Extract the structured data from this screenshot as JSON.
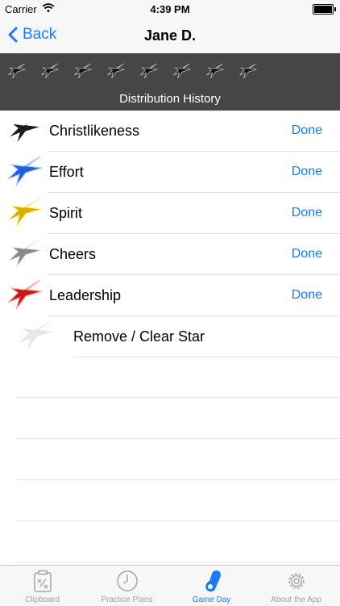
{
  "status_bar": {
    "carrier": "Carrier",
    "time": "4:39 PM"
  },
  "nav": {
    "back_label": "Back",
    "title": "Jane D."
  },
  "history": {
    "title": "Distribution History",
    "star_count": 8
  },
  "items": [
    {
      "label": "Christlikeness",
      "action": "Done",
      "star_color": "#1c1c1c",
      "star_highlight": "#ffffff"
    },
    {
      "label": "Effort",
      "action": "Done",
      "star_color": "#1f5fe0",
      "star_highlight": "#a9c8ff"
    },
    {
      "label": "Spirit",
      "action": "Done",
      "star_color": "#d8b000",
      "star_highlight": "#fff2a0"
    },
    {
      "label": "Cheers",
      "action": "Done",
      "star_color": "#8a8a8a",
      "star_highlight": "#f2f2f2"
    },
    {
      "label": "Leadership",
      "action": "Done",
      "star_color": "#c81818",
      "star_highlight": "#ffb0b0"
    }
  ],
  "remove": {
    "label": "Remove / Clear Star",
    "star_color": "#e6e6e6"
  },
  "tabs": [
    {
      "label": "Clipboard",
      "icon": "clipboard-icon",
      "active": false
    },
    {
      "label": "Practice Plans",
      "icon": "clock-icon",
      "active": false
    },
    {
      "label": "Game Day",
      "icon": "whistle-icon",
      "active": true
    },
    {
      "label": "About the App",
      "icon": "gear-icon",
      "active": false
    }
  ],
  "colors": {
    "accent": "#1a7cf5",
    "history_bg": "#464646"
  }
}
